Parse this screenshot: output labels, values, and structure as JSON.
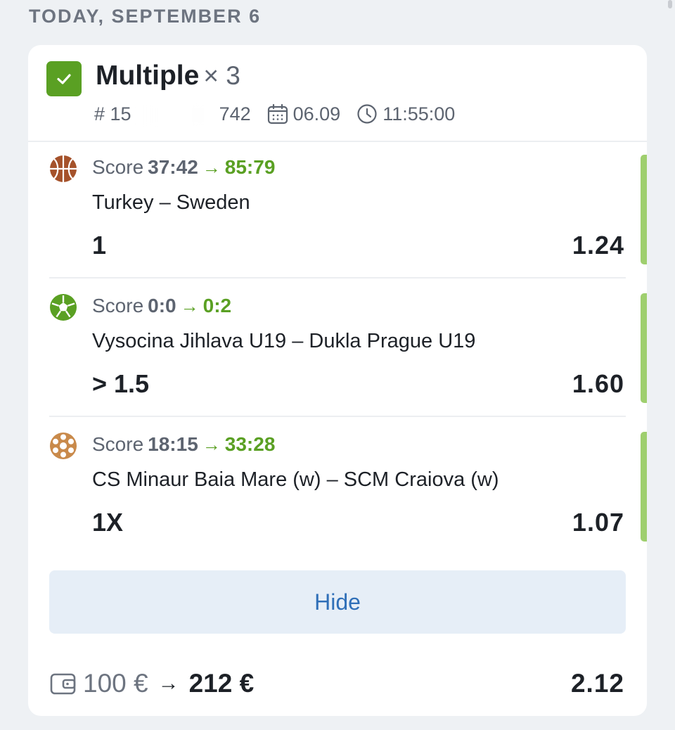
{
  "date_header": "TODAY, SEPTEMBER 6",
  "bet": {
    "title": "Multiple",
    "count": "× 3",
    "id_prefix": "# 15",
    "id_suffix": "742",
    "date": "06.09",
    "time": "11:55:00",
    "status_color": "#5aa023"
  },
  "events": [
    {
      "sport_icon": "basketball-icon",
      "score_label": "Score",
      "score_from": "37:42",
      "score_arrow": "→",
      "score_to": "85:79",
      "teams": "Turkey – Sweden",
      "pick": "1",
      "odds": "1.24"
    },
    {
      "sport_icon": "soccer-ball-icon",
      "score_label": "Score",
      "score_from": "0:0",
      "score_arrow": "→",
      "score_to": "0:2",
      "teams": "Vysocina Jihlava U19 – Dukla Prague U19",
      "pick": "> 1.5",
      "odds": "1.60"
    },
    {
      "sport_icon": "handball-icon",
      "score_label": "Score",
      "score_from": "18:15",
      "score_arrow": "→",
      "score_to": "33:28",
      "teams": "CS Minaur Baia Mare (w) – SCM Craiova (w)",
      "pick": "1X",
      "odds": "1.07"
    }
  ],
  "hide_label": "Hide",
  "footer": {
    "stake": "100 €",
    "arrow": "→",
    "payout": "212 €",
    "total_odds": "2.12"
  },
  "colors": {
    "win": "#5aa023",
    "win_bar": "#9fcf6e",
    "link": "#2f6fb8"
  }
}
